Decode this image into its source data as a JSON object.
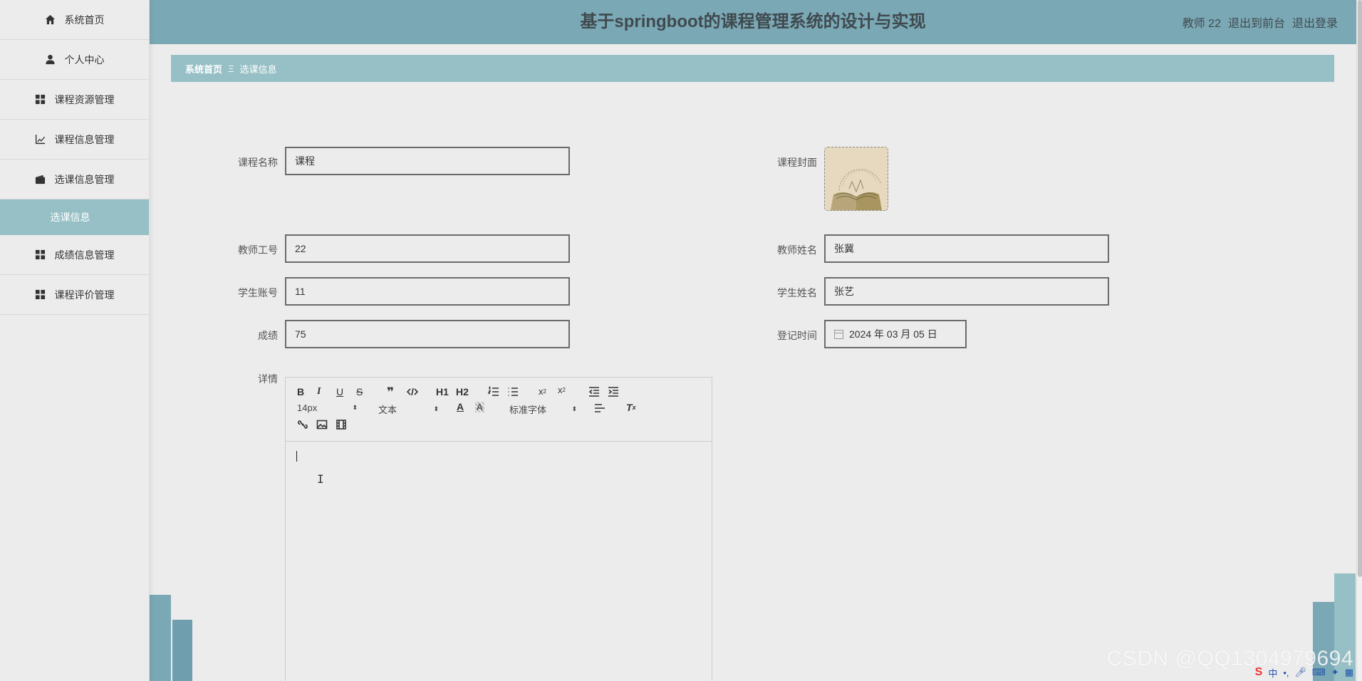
{
  "app": {
    "title": "基于springboot的课程管理系统的设计与实现",
    "user": "教师 22",
    "to_front": "退出到前台",
    "logout": "退出登录"
  },
  "sidebar": {
    "items": [
      {
        "label": "系统首页",
        "icon": "home-icon"
      },
      {
        "label": "个人中心",
        "icon": "user-icon"
      },
      {
        "label": "课程资源管理",
        "icon": "grid-icon"
      },
      {
        "label": "课程信息管理",
        "icon": "chart-icon"
      },
      {
        "label": "选课信息管理",
        "icon": "wallet-icon"
      },
      {
        "label": "成绩信息管理",
        "icon": "grid-icon"
      },
      {
        "label": "课程评价管理",
        "icon": "grid-icon"
      }
    ],
    "active_sub": "选课信息"
  },
  "breadcrumb": {
    "home": "系统首页",
    "separator": "Ξ",
    "current": "选课信息"
  },
  "form": {
    "course_name_label": "课程名称",
    "course_name_value": "课程",
    "cover_label": "课程封面",
    "teacher_id_label": "教师工号",
    "teacher_id_value": "22",
    "teacher_name_label": "教师姓名",
    "teacher_name_value": "张冀",
    "student_account_label": "学生账号",
    "student_account_value": "11",
    "student_name_label": "学生姓名",
    "student_name_value": "张艺",
    "score_label": "成绩",
    "score_value": "75",
    "register_time_label": "登记时间",
    "register_time_value": "2024 年 03 月 05 日",
    "detail_label": "详情"
  },
  "editor": {
    "font_size": "14px",
    "text_style": "文本",
    "font_family": "标准字体",
    "h1": "H1",
    "h2": "H2"
  },
  "watermark": "CSDN @QQ1304979694",
  "tray": {
    "ime": "中"
  }
}
